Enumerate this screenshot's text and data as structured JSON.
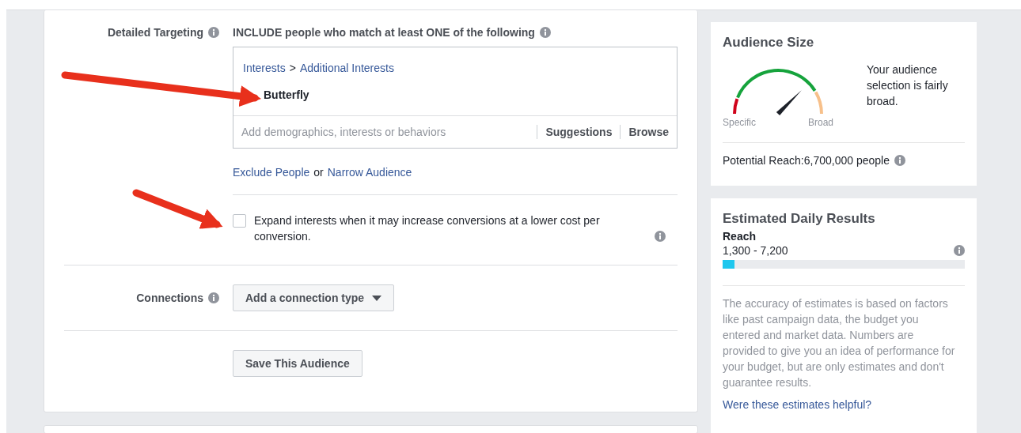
{
  "targeting": {
    "label": "Detailed Targeting",
    "include_text": "INCLUDE people who match at least ONE of the following",
    "breadcrumb": [
      "Interests",
      "Additional Interests"
    ],
    "breadcrumb_separator": ">",
    "selected_item": "Butterfly",
    "search": {
      "placeholder": "Add demographics, interests or behaviors"
    },
    "actions": [
      "Suggestions",
      "Browse"
    ],
    "links": {
      "exclude": "Exclude People",
      "joiner": "or",
      "narrow": "Narrow Audience"
    },
    "expand": {
      "checked": false,
      "text": "Expand interests when it may increase conversions at a lower cost per conversion."
    }
  },
  "connections": {
    "label": "Connections",
    "dropdown": "Add a connection type"
  },
  "save_button": "Save This Audience",
  "audience_size": {
    "title": "Audience Size",
    "low_label": "Specific",
    "high_label": "Broad",
    "description": "Your audience selection is fairly broad.",
    "potential_reach": "Potential Reach:6,700,000 people"
  },
  "daily_results": {
    "title": "Estimated Daily Results",
    "metric": "Reach",
    "range": "1,300 - 7,200",
    "level": 0.05,
    "note": "The accuracy of estimates is based on factors like past campaign data, the budget you entered and market data. Numbers are provided to give you an idea of performance for your budget, but are only estimates and don't guarantee results.",
    "feedback_link": "Were these estimates helpful?"
  }
}
